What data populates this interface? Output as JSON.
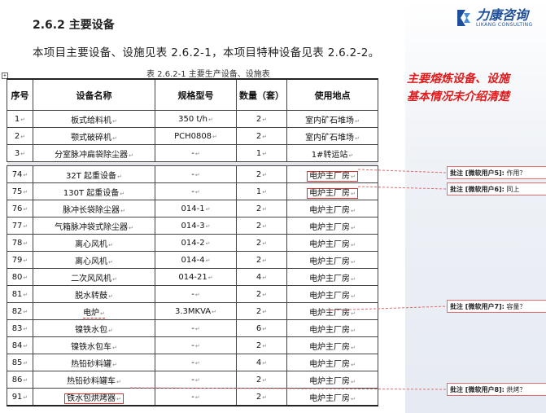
{
  "section": {
    "heading": "2.6.2 主要设备",
    "intro": "本项目主要设备、设施见表 2.6.2-1，本项目特种设备见表 2.6.2-2。",
    "caption": "表 2.6.2-1  主要生产设备、设施表"
  },
  "logo": {
    "name": "力康咨询",
    "tagline": "LIKANG CONSULTING"
  },
  "note": {
    "line1": "主要熔炼设备、设施",
    "line2": "基本情况未介绍清楚"
  },
  "table": {
    "headers": [
      "序号",
      "设备名称",
      "规格型号",
      "数量（套）",
      "使用地点"
    ],
    "rows": [
      {
        "no": "1",
        "name": "板式给料机",
        "spec": "350  t/h",
        "qty": "2",
        "loc": "室内矿石堆场"
      },
      {
        "no": "2",
        "name": "颚式破碎机",
        "spec": "PCH0808",
        "qty": "2",
        "loc": "室内矿石堆场"
      },
      {
        "no": "3",
        "name": "分室脉冲扁袋除尘器",
        "spec": "-",
        "qty": "1",
        "loc": "1#转运站"
      },
      {
        "no": "74",
        "name": "32T 起重设备",
        "spec": "-",
        "qty": "2",
        "loc": "电炉主厂房"
      },
      {
        "no": "75",
        "name": "130T 起重设备",
        "spec": "-",
        "qty": "1",
        "loc": "电炉主厂房"
      },
      {
        "no": "76",
        "name": "脉冲长袋除尘器",
        "spec": "014-1",
        "qty": "2",
        "loc": "电炉主厂房"
      },
      {
        "no": "77",
        "name": "气箱脉冲袋式除尘器",
        "spec": "014-3",
        "qty": "2",
        "loc": "电炉主厂房"
      },
      {
        "no": "78",
        "name": "离心风机",
        "spec": "014-2",
        "qty": "2",
        "loc": "电炉主厂房"
      },
      {
        "no": "79",
        "name": "离心风机",
        "spec": "014-4",
        "qty": "2",
        "loc": "电炉主厂房"
      },
      {
        "no": "80",
        "name": "二次风风机",
        "spec": "014-21",
        "qty": "4",
        "loc": "电炉主厂房"
      },
      {
        "no": "81",
        "name": "脱水转鼓",
        "spec": "-",
        "qty": "2",
        "loc": "电炉主厂房"
      },
      {
        "no": "82",
        "name": "电炉",
        "spec": "3.3MKVA",
        "qty": "2",
        "loc": "电炉主厂房"
      },
      {
        "no": "83",
        "name": "镍铁水包",
        "spec": "-",
        "qty": "6",
        "loc": "电炉主厂房"
      },
      {
        "no": "84",
        "name": "镍铁水包车",
        "spec": "-",
        "qty": "2",
        "loc": "电炉主厂房"
      },
      {
        "no": "85",
        "name": "热铅砂料罐",
        "spec": "-",
        "qty": "4",
        "loc": "电炉主厂房"
      },
      {
        "no": "86",
        "name": "热铅砂料罐车",
        "spec": "-",
        "qty": "2",
        "loc": "电炉主厂房"
      },
      {
        "no": "91",
        "name": "铁水包烘烤器",
        "spec": "-",
        "qty": "2",
        "loc": "电炉主厂房"
      }
    ]
  },
  "comments": [
    {
      "label": "批注 [微软用户5]:",
      "text": "作用？"
    },
    {
      "label": "批注 [微软用户6]:",
      "text": "同上"
    },
    {
      "label": "批注 [微软用户7]:",
      "text": "容量？"
    },
    {
      "label": "批注 [微软用户8]:",
      "text": "烘烤？"
    }
  ]
}
